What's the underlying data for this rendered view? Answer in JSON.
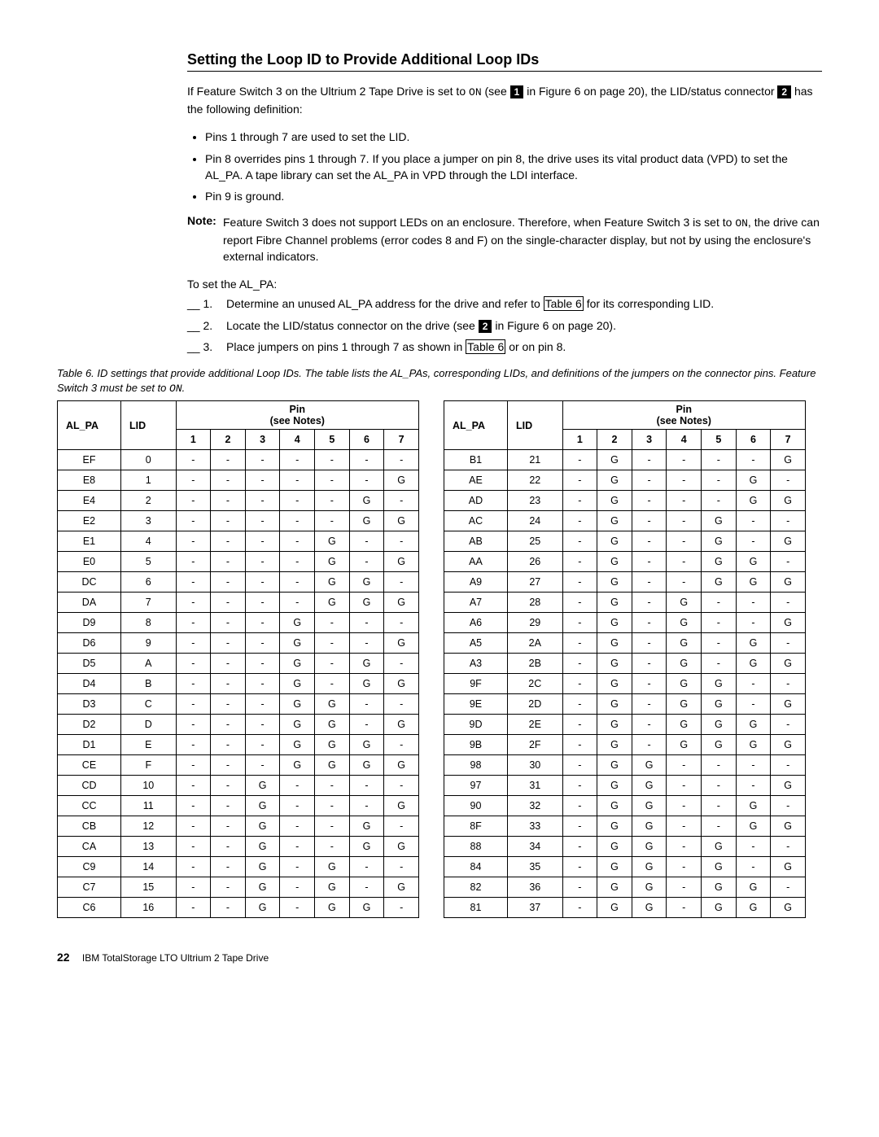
{
  "heading": "Setting the Loop ID to Provide Additional Loop IDs",
  "intro_a": "If Feature Switch 3 on the Ultrium 2 Tape Drive is set to ",
  "on": "ON",
  "intro_b": " (see ",
  "box1": "1",
  "intro_c": " in Figure 6 on page 20), the LID/status connector ",
  "box2": "2",
  "intro_d": " has the following definition:",
  "bullets": [
    "Pins 1 through 7 are used to set the LID.",
    "Pin 8 overrides pins 1 through 7. If you place a jumper on pin 8, the drive uses its vital product data (VPD) to set the AL_PA. A tape library can set the AL_PA in VPD through the LDI interface.",
    "Pin 9 is ground."
  ],
  "note_label": "Note:",
  "note_a": "Feature Switch 3 does not support LEDs on an enclosure. Therefore, when Feature Switch 3 is set to ",
  "note_b": ", the drive can report Fibre Channel problems (error codes 8 and F) on the single-character display, but not by using the enclosure's external indicators.",
  "to_set": "To set the AL_PA:",
  "steps": [
    {
      "n": "__ 1.",
      "a": "Determine an unused AL_PA address for the drive and refer to ",
      "x": "Table 6",
      "b": " for its corresponding LID."
    },
    {
      "n": "__ 2.",
      "a": "Locate the LID/status connector on the drive (see ",
      "box": "2",
      "b": " in Figure 6 on page 20)."
    },
    {
      "n": "__ 3.",
      "a": "Place jumpers on pins 1 through 7 as shown in ",
      "x": "Table 6",
      "b": " or on pin 8."
    }
  ],
  "caption_a": "Table 6. ID settings that provide additional Loop IDs.  The table lists the AL_PAs, corresponding LIDs, and definitions of the jumpers on the connector pins. Feature Switch 3 must be set to ",
  "hdr_alpa": "AL_PA",
  "hdr_lid": "LID",
  "hdr_pin": "Pin",
  "hdr_notes": "(see Notes)",
  "pin_nums": [
    "1",
    "2",
    "3",
    "4",
    "5",
    "6",
    "7"
  ],
  "left": [
    {
      "a": "EF",
      "l": "0",
      "p": [
        "-",
        "-",
        "-",
        "-",
        "-",
        "-",
        "-"
      ]
    },
    {
      "a": "E8",
      "l": "1",
      "p": [
        "-",
        "-",
        "-",
        "-",
        "-",
        "-",
        "G"
      ]
    },
    {
      "a": "E4",
      "l": "2",
      "p": [
        "-",
        "-",
        "-",
        "-",
        "-",
        "G",
        "-"
      ]
    },
    {
      "a": "E2",
      "l": "3",
      "p": [
        "-",
        "-",
        "-",
        "-",
        "-",
        "G",
        "G"
      ]
    },
    {
      "a": "E1",
      "l": "4",
      "p": [
        "-",
        "-",
        "-",
        "-",
        "G",
        "-",
        "-"
      ]
    },
    {
      "a": "E0",
      "l": "5",
      "p": [
        "-",
        "-",
        "-",
        "-",
        "G",
        "-",
        "G"
      ]
    },
    {
      "a": "DC",
      "l": "6",
      "p": [
        "-",
        "-",
        "-",
        "-",
        "G",
        "G",
        "-"
      ]
    },
    {
      "a": "DA",
      "l": "7",
      "p": [
        "-",
        "-",
        "-",
        "-",
        "G",
        "G",
        "G"
      ]
    },
    {
      "a": "D9",
      "l": "8",
      "p": [
        "-",
        "-",
        "-",
        "G",
        "-",
        "-",
        "-"
      ]
    },
    {
      "a": "D6",
      "l": "9",
      "p": [
        "-",
        "-",
        "-",
        "G",
        "-",
        "-",
        "G"
      ]
    },
    {
      "a": "D5",
      "l": "A",
      "p": [
        "-",
        "-",
        "-",
        "G",
        "-",
        "G",
        "-"
      ]
    },
    {
      "a": "D4",
      "l": "B",
      "p": [
        "-",
        "-",
        "-",
        "G",
        "-",
        "G",
        "G"
      ]
    },
    {
      "a": "D3",
      "l": "C",
      "p": [
        "-",
        "-",
        "-",
        "G",
        "G",
        "-",
        "-"
      ]
    },
    {
      "a": "D2",
      "l": "D",
      "p": [
        "-",
        "-",
        "-",
        "G",
        "G",
        "-",
        "G"
      ]
    },
    {
      "a": "D1",
      "l": "E",
      "p": [
        "-",
        "-",
        "-",
        "G",
        "G",
        "G",
        "-"
      ]
    },
    {
      "a": "CE",
      "l": "F",
      "p": [
        "-",
        "-",
        "-",
        "G",
        "G",
        "G",
        "G"
      ]
    },
    {
      "a": "CD",
      "l": "10",
      "p": [
        "-",
        "-",
        "G",
        "-",
        "-",
        "-",
        "-"
      ]
    },
    {
      "a": "CC",
      "l": "11",
      "p": [
        "-",
        "-",
        "G",
        "-",
        "-",
        "-",
        "G"
      ]
    },
    {
      "a": "CB",
      "l": "12",
      "p": [
        "-",
        "-",
        "G",
        "-",
        "-",
        "G",
        "-"
      ]
    },
    {
      "a": "CA",
      "l": "13",
      "p": [
        "-",
        "-",
        "G",
        "-",
        "-",
        "G",
        "G"
      ]
    },
    {
      "a": "C9",
      "l": "14",
      "p": [
        "-",
        "-",
        "G",
        "-",
        "G",
        "-",
        "-"
      ]
    },
    {
      "a": "C7",
      "l": "15",
      "p": [
        "-",
        "-",
        "G",
        "-",
        "G",
        "-",
        "G"
      ]
    },
    {
      "a": "C6",
      "l": "16",
      "p": [
        "-",
        "-",
        "G",
        "-",
        "G",
        "G",
        "-"
      ]
    }
  ],
  "right": [
    {
      "a": "B1",
      "l": "21",
      "p": [
        "-",
        "G",
        "-",
        "-",
        "-",
        "-",
        "G"
      ]
    },
    {
      "a": "AE",
      "l": "22",
      "p": [
        "-",
        "G",
        "-",
        "-",
        "-",
        "G",
        "-"
      ]
    },
    {
      "a": "AD",
      "l": "23",
      "p": [
        "-",
        "G",
        "-",
        "-",
        "-",
        "G",
        "G"
      ]
    },
    {
      "a": "AC",
      "l": "24",
      "p": [
        "-",
        "G",
        "-",
        "-",
        "G",
        "-",
        "-"
      ]
    },
    {
      "a": "AB",
      "l": "25",
      "p": [
        "-",
        "G",
        "-",
        "-",
        "G",
        "-",
        "G"
      ]
    },
    {
      "a": "AA",
      "l": "26",
      "p": [
        "-",
        "G",
        "-",
        "-",
        "G",
        "G",
        "-"
      ]
    },
    {
      "a": "A9",
      "l": "27",
      "p": [
        "-",
        "G",
        "-",
        "-",
        "G",
        "G",
        "G"
      ]
    },
    {
      "a": "A7",
      "l": "28",
      "p": [
        "-",
        "G",
        "-",
        "G",
        "-",
        "-",
        "-"
      ]
    },
    {
      "a": "A6",
      "l": "29",
      "p": [
        "-",
        "G",
        "-",
        "G",
        "-",
        "-",
        "G"
      ]
    },
    {
      "a": "A5",
      "l": "2A",
      "p": [
        "-",
        "G",
        "-",
        "G",
        "-",
        "G",
        "-"
      ]
    },
    {
      "a": "A3",
      "l": "2B",
      "p": [
        "-",
        "G",
        "-",
        "G",
        "-",
        "G",
        "G"
      ]
    },
    {
      "a": "9F",
      "l": "2C",
      "p": [
        "-",
        "G",
        "-",
        "G",
        "G",
        "-",
        "-"
      ]
    },
    {
      "a": "9E",
      "l": "2D",
      "p": [
        "-",
        "G",
        "-",
        "G",
        "G",
        "-",
        "G"
      ]
    },
    {
      "a": "9D",
      "l": "2E",
      "p": [
        "-",
        "G",
        "-",
        "G",
        "G",
        "G",
        "-"
      ]
    },
    {
      "a": "9B",
      "l": "2F",
      "p": [
        "-",
        "G",
        "-",
        "G",
        "G",
        "G",
        "G"
      ]
    },
    {
      "a": "98",
      "l": "30",
      "p": [
        "-",
        "G",
        "G",
        "-",
        "-",
        "-",
        "-"
      ]
    },
    {
      "a": "97",
      "l": "31",
      "p": [
        "-",
        "G",
        "G",
        "-",
        "-",
        "-",
        "G"
      ]
    },
    {
      "a": "90",
      "l": "32",
      "p": [
        "-",
        "G",
        "G",
        "-",
        "-",
        "G",
        "-"
      ]
    },
    {
      "a": "8F",
      "l": "33",
      "p": [
        "-",
        "G",
        "G",
        "-",
        "-",
        "G",
        "G"
      ]
    },
    {
      "a": "88",
      "l": "34",
      "p": [
        "-",
        "G",
        "G",
        "-",
        "G",
        "-",
        "-"
      ]
    },
    {
      "a": "84",
      "l": "35",
      "p": [
        "-",
        "G",
        "G",
        "-",
        "G",
        "-",
        "G"
      ]
    },
    {
      "a": "82",
      "l": "36",
      "p": [
        "-",
        "G",
        "G",
        "-",
        "G",
        "G",
        "-"
      ]
    },
    {
      "a": "81",
      "l": "37",
      "p": [
        "-",
        "G",
        "G",
        "-",
        "G",
        "G",
        "G"
      ]
    }
  ],
  "footer_page": "22",
  "footer_text": "IBM TotalStorage LTO Ultrium 2 Tape Drive"
}
